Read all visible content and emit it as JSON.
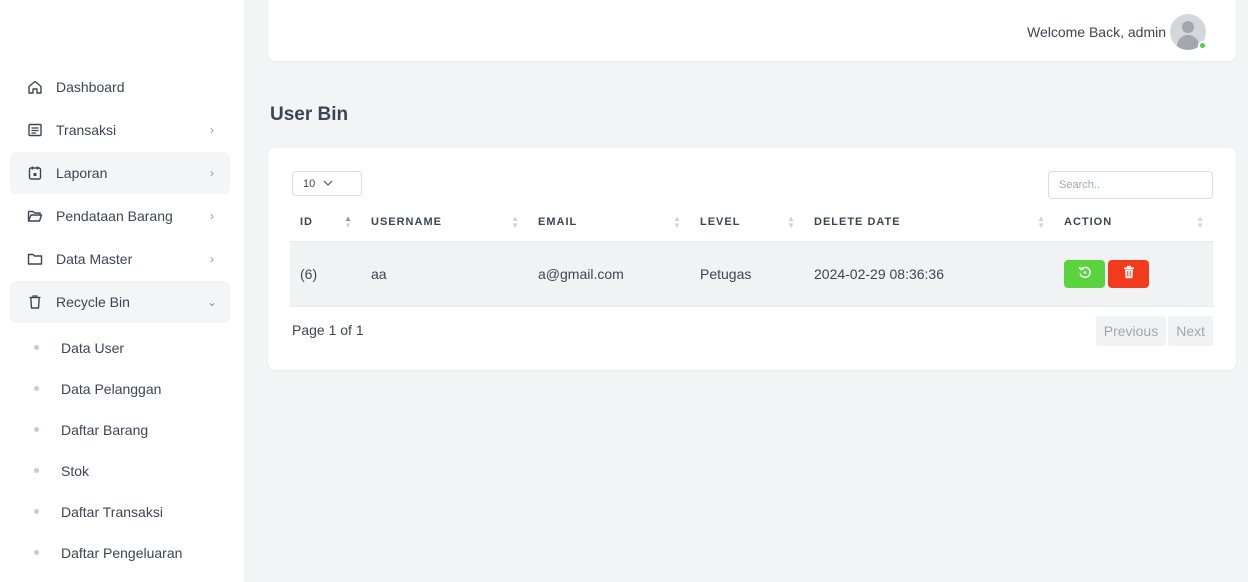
{
  "sidebar": {
    "items": [
      {
        "label": "Dashboard",
        "icon": "home-icon",
        "has_chevron": false
      },
      {
        "label": "Transaksi",
        "icon": "receipt-icon",
        "has_chevron": true
      },
      {
        "label": "Laporan",
        "icon": "calendar-icon",
        "has_chevron": true
      },
      {
        "label": "Pendataan Barang",
        "icon": "folder-open-icon",
        "has_chevron": true
      },
      {
        "label": "Data Master",
        "icon": "folder-icon",
        "has_chevron": true
      },
      {
        "label": "Recycle Bin",
        "icon": "trash-icon",
        "has_chevron": true,
        "expanded": true
      }
    ],
    "chevron_right": "›",
    "chevron_down": "⌄",
    "subitems": [
      {
        "label": "Data User"
      },
      {
        "label": "Data Pelanggan"
      },
      {
        "label": "Daftar Barang"
      },
      {
        "label": "Stok"
      },
      {
        "label": "Daftar Transaksi"
      },
      {
        "label": "Daftar Pengeluaran"
      }
    ]
  },
  "header": {
    "welcome_text": "Welcome Back, admin",
    "status_color": "#4cd137"
  },
  "page": {
    "title": "User Bin"
  },
  "table": {
    "length_value": "10",
    "search_placeholder": "Search..",
    "columns": [
      "ID",
      "USERNAME",
      "EMAIL",
      "LEVEL",
      "DELETE DATE",
      "ACTION"
    ],
    "rows": [
      {
        "id": "(6)",
        "username": "aa",
        "email": "a@gmail.com",
        "level": "Petugas",
        "delete_date": "2024-02-29 08:36:36"
      }
    ],
    "restore_color": "#5ad43e",
    "delete_color": "#f23b1d",
    "info": "Page 1 of 1",
    "previous_label": "Previous",
    "next_label": "Next"
  }
}
